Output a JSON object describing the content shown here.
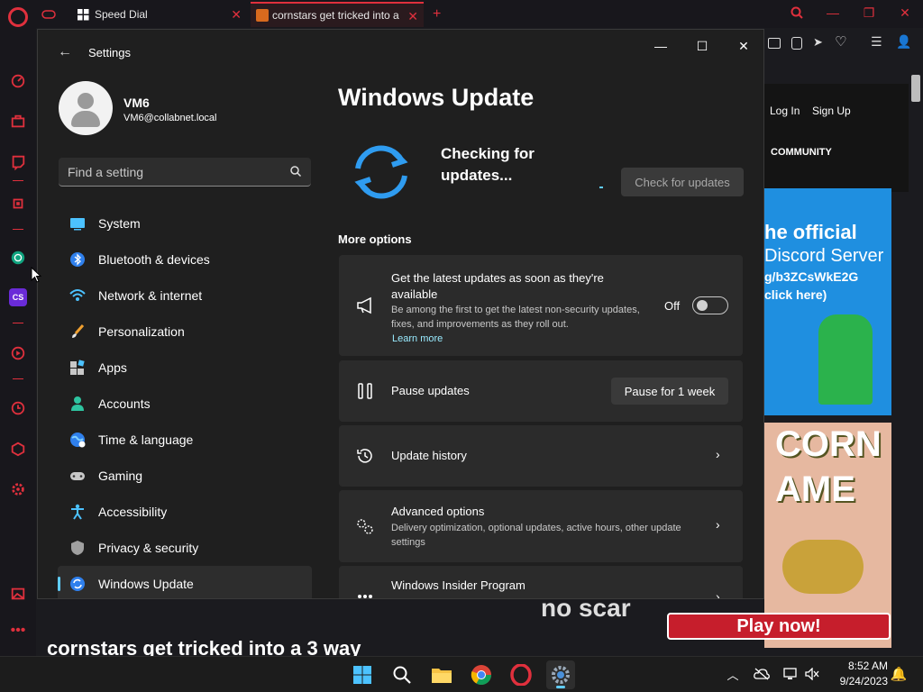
{
  "browser": {
    "tabs": [
      {
        "label": "Speed Dial",
        "active": false
      },
      {
        "label": "cornstars get tricked into a",
        "active": true
      }
    ],
    "new_tab": "+",
    "sidebar_badge": "CS"
  },
  "webpage": {
    "login": "Log In",
    "signup": "Sign Up",
    "community": "COMMUNITY",
    "banner1_lines": [
      "he official",
      "Discord Server",
      "g/b3ZCsWkE2G",
      "click here)"
    ],
    "banner2_lines": [
      "CORN",
      "AME"
    ],
    "no_scar": "no scar",
    "play_now": "Play now!",
    "bottom_text": "cornstars get tricked into a 3 way"
  },
  "settings": {
    "window_title": "Settings",
    "profile": {
      "name": "VM6",
      "email": "VM6@collabnet.local"
    },
    "search_placeholder": "Find a setting",
    "nav": [
      {
        "label": "System",
        "icon": "system-icon"
      },
      {
        "label": "Bluetooth & devices",
        "icon": "bluetooth-icon"
      },
      {
        "label": "Network & internet",
        "icon": "network-icon"
      },
      {
        "label": "Personalization",
        "icon": "brush-icon"
      },
      {
        "label": "Apps",
        "icon": "apps-icon"
      },
      {
        "label": "Accounts",
        "icon": "accounts-icon"
      },
      {
        "label": "Time & language",
        "icon": "globe-icon"
      },
      {
        "label": "Gaming",
        "icon": "gamepad-icon"
      },
      {
        "label": "Accessibility",
        "icon": "accessibility-icon"
      },
      {
        "label": "Privacy & security",
        "icon": "shield-icon"
      },
      {
        "label": "Windows Update",
        "icon": "windows-update-icon"
      }
    ],
    "active_nav": "Windows Update",
    "page_title": "Windows Update",
    "status": "Checking for updates...",
    "check_button": "Check for updates",
    "more_options": "More options",
    "cards": {
      "latest": {
        "title": "Get the latest updates as soon as they're available",
        "desc": "Be among the first to get the latest non-security updates, fixes, and improvements as they roll out.",
        "link": "Learn more",
        "toggle_label": "Off",
        "toggle_on": false
      },
      "pause": {
        "title": "Pause updates",
        "button": "Pause for 1 week"
      },
      "history": {
        "title": "Update history"
      },
      "advanced": {
        "title": "Advanced options",
        "desc": "Delivery optimization, optional updates, active hours, other update settings"
      },
      "insider": {
        "title": "Windows Insider Program"
      }
    }
  },
  "taskbar": {
    "time": "8:52 AM",
    "date": "9/24/2023"
  },
  "colors": {
    "accent": "#60cdff",
    "opera_red": "#e0303d",
    "window_bg": "#1f1f1f",
    "card_bg": "#2b2b2b"
  }
}
